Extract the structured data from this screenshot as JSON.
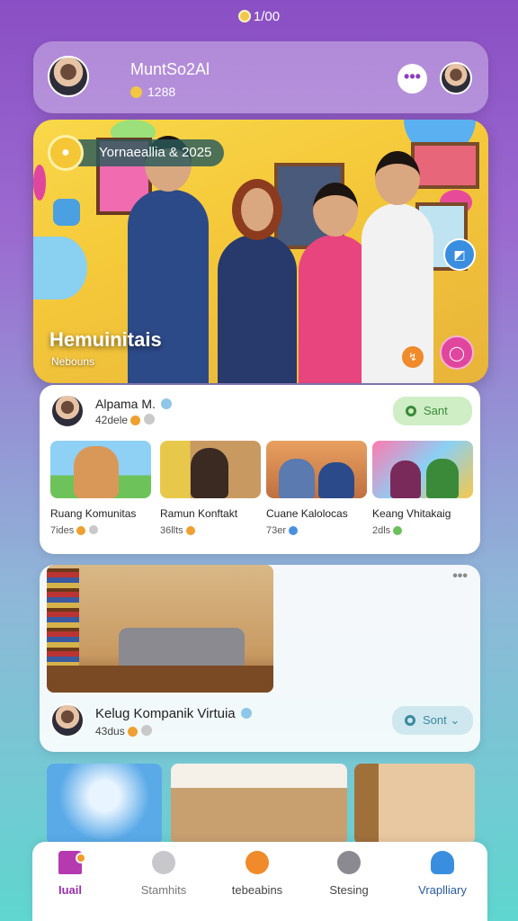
{
  "status_bar": {
    "time": "1/00"
  },
  "header": {
    "username": "MuntSo2Al",
    "coins": "1288"
  },
  "hero": {
    "tag_text": "Yornaeallia & 2025",
    "title": "Hemuinitais",
    "subtitle": "Nebouns"
  },
  "community_card": {
    "name": "Alpama M.",
    "meta": "42dele",
    "sort_label": "Sant",
    "tiles": [
      {
        "title": "Ruang Komunitas",
        "meta": "7ides"
      },
      {
        "title": "Ramun Konftakt",
        "meta": "36llts"
      },
      {
        "title": "Cuane Kalolocas",
        "meta": "73er"
      },
      {
        "title": "Keang Vhitakaig",
        "meta": "2dls"
      }
    ]
  },
  "post_card": {
    "name": "Kelug Kompanik Virtuia",
    "meta": "43dus",
    "sort_label": "Sont"
  },
  "bottom_nav": {
    "items": [
      {
        "label": "Iuail"
      },
      {
        "label": "Stamhits"
      },
      {
        "label": "tebeabins"
      },
      {
        "label": "Stesing"
      },
      {
        "label": "Vraplliary"
      }
    ]
  },
  "colors": {
    "accent": "#9a2fb0",
    "sort_green": "#cfeec5",
    "sort_blue": "#cfe8f0",
    "coin": "#f3c642"
  },
  "icons": [
    "home-icon",
    "search-icon",
    "explore-icon",
    "settings-icon",
    "profile-icon",
    "more-icon",
    "map-icon",
    "chat-icon",
    "gear-icon",
    "verified-icon"
  ]
}
